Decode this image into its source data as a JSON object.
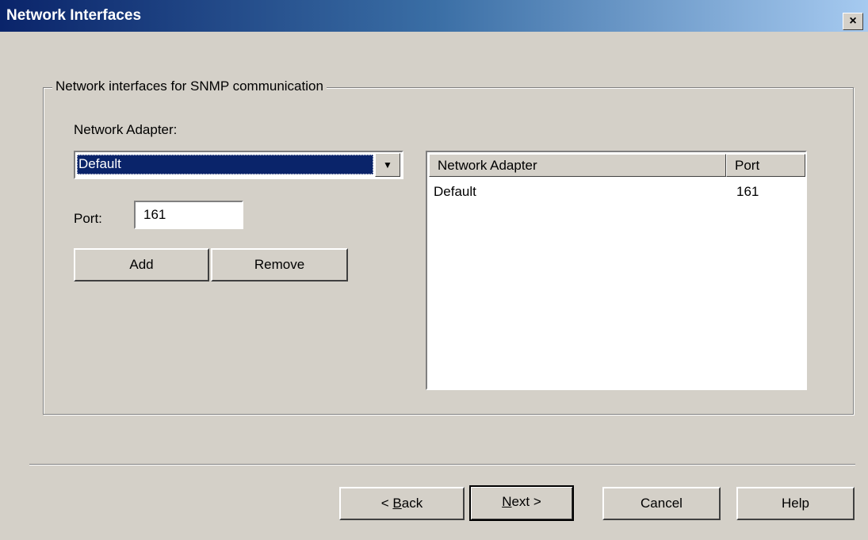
{
  "window": {
    "title": "Network Interfaces",
    "close_label": "×"
  },
  "group": {
    "legend": "Network interfaces for SNMP communication"
  },
  "adapter": {
    "label": "Network Adapter:",
    "selected": "Default",
    "dropdown_icon": "▼"
  },
  "port": {
    "label": "Port:",
    "value": "161"
  },
  "actions": {
    "add_label": "Add",
    "remove_label": "Remove"
  },
  "list": {
    "columns": [
      "Network Adapter",
      "Port"
    ],
    "rows": [
      {
        "adapter": "Default",
        "port": "161"
      }
    ]
  },
  "footer": {
    "back_prefix": "< ",
    "back_accel": "B",
    "back_rest": "ack",
    "next_accel": "N",
    "next_rest": "ext >",
    "cancel_label": "Cancel",
    "help_label": "Help"
  }
}
